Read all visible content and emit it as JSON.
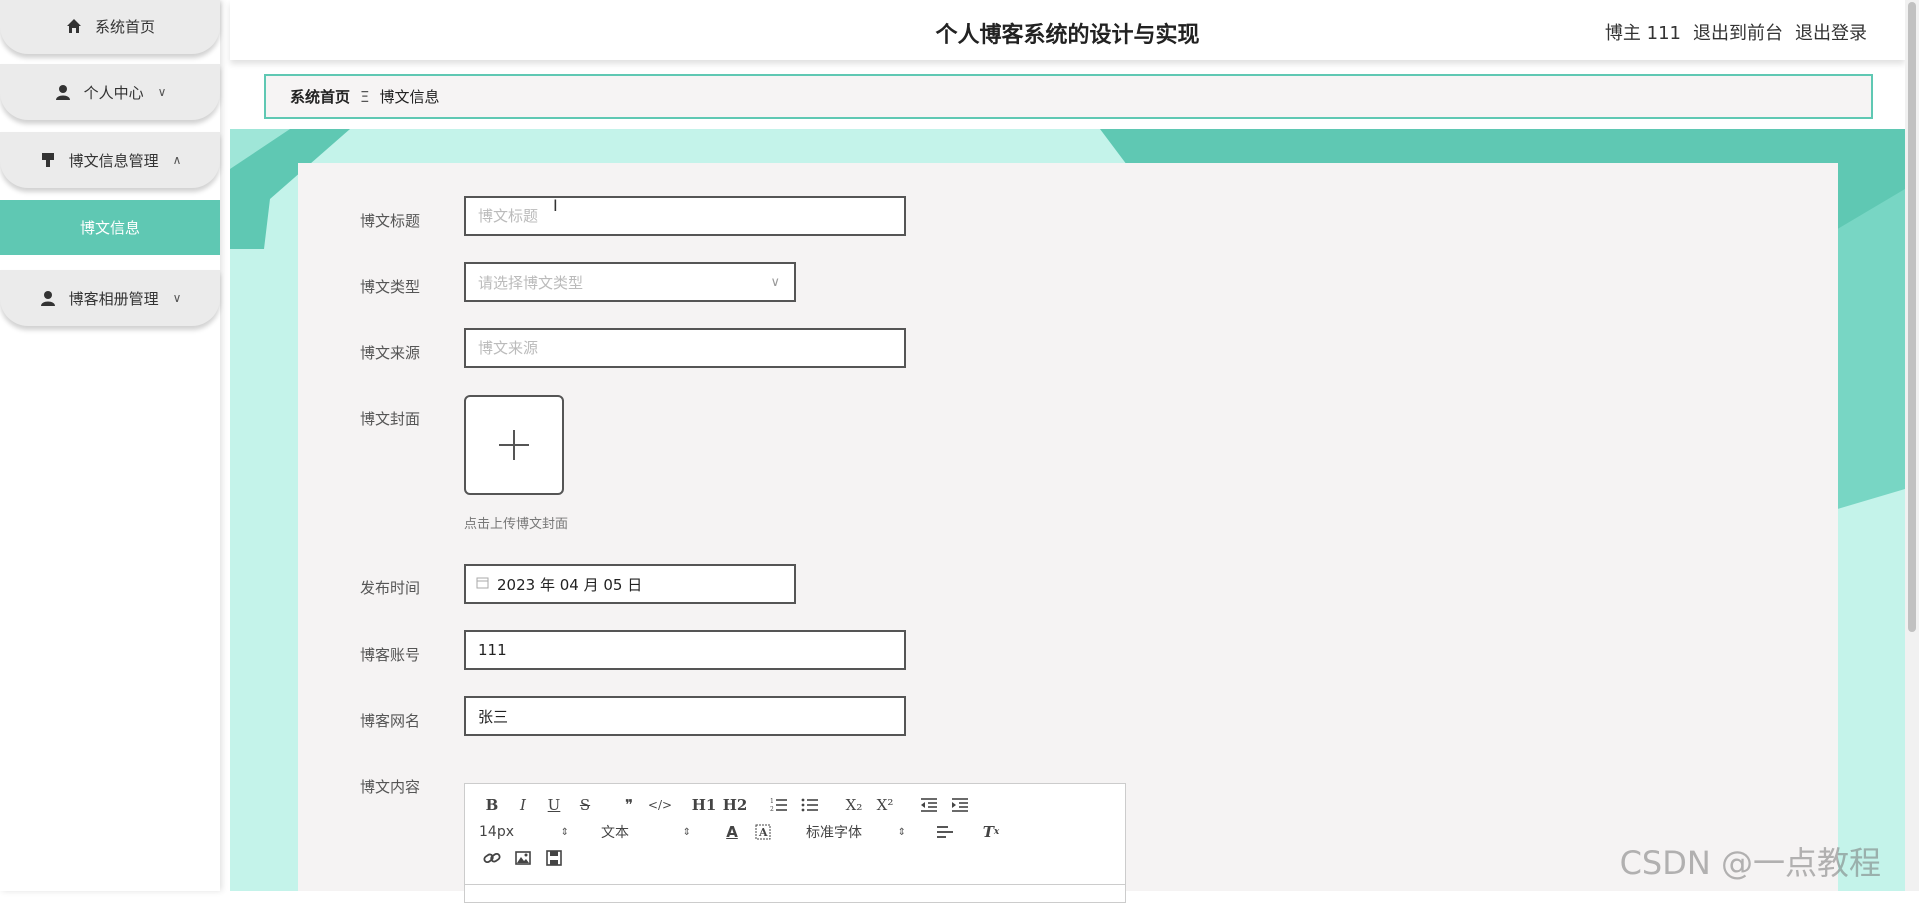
{
  "app": {
    "title": "个人博客系统的设计与实现",
    "user_label": "博主 111",
    "back_to_front": "退出到前台",
    "logout": "退出登录"
  },
  "sidebar": {
    "items": [
      {
        "label": "系统首页",
        "icon": "home-icon"
      },
      {
        "label": "个人中心",
        "icon": "user-icon",
        "chevron": "down"
      },
      {
        "label": "博文信息管理",
        "icon": "brush-icon",
        "chevron": "up"
      },
      {
        "label": "博客相册管理",
        "icon": "user-icon",
        "chevron": "down"
      }
    ],
    "active_sub": "博文信息"
  },
  "breadcrumb": {
    "home": "系统首页",
    "separator": "Ξ",
    "current": "博文信息"
  },
  "form": {
    "title": {
      "label": "博文标题",
      "placeholder": "博文标题",
      "value": ""
    },
    "type": {
      "label": "博文类型",
      "placeholder": "请选择博文类型"
    },
    "source": {
      "label": "博文来源",
      "placeholder": "博文来源",
      "value": ""
    },
    "cover": {
      "label": "博文封面",
      "hint": "点击上传博文封面"
    },
    "publish_time": {
      "label": "发布时间",
      "value": "2023 年 04 月 05 日"
    },
    "account": {
      "label": "博客账号",
      "value": "111"
    },
    "nickname": {
      "label": "博客网名",
      "value": "张三"
    },
    "content": {
      "label": "博文内容"
    }
  },
  "editor": {
    "font_size": "14px",
    "header_select": "文本",
    "font_family": "标准字体",
    "buttons": [
      "B",
      "I",
      "U",
      "S",
      "❞",
      "</>",
      "H1",
      "H2",
      "ordered-list",
      "bullet-list",
      "X₂",
      "X²",
      "outdent",
      "indent"
    ]
  },
  "watermark": "CSDN @一点教程",
  "colors": {
    "accent": "#5fc8b3",
    "banner_light": "#c4f3ea"
  }
}
